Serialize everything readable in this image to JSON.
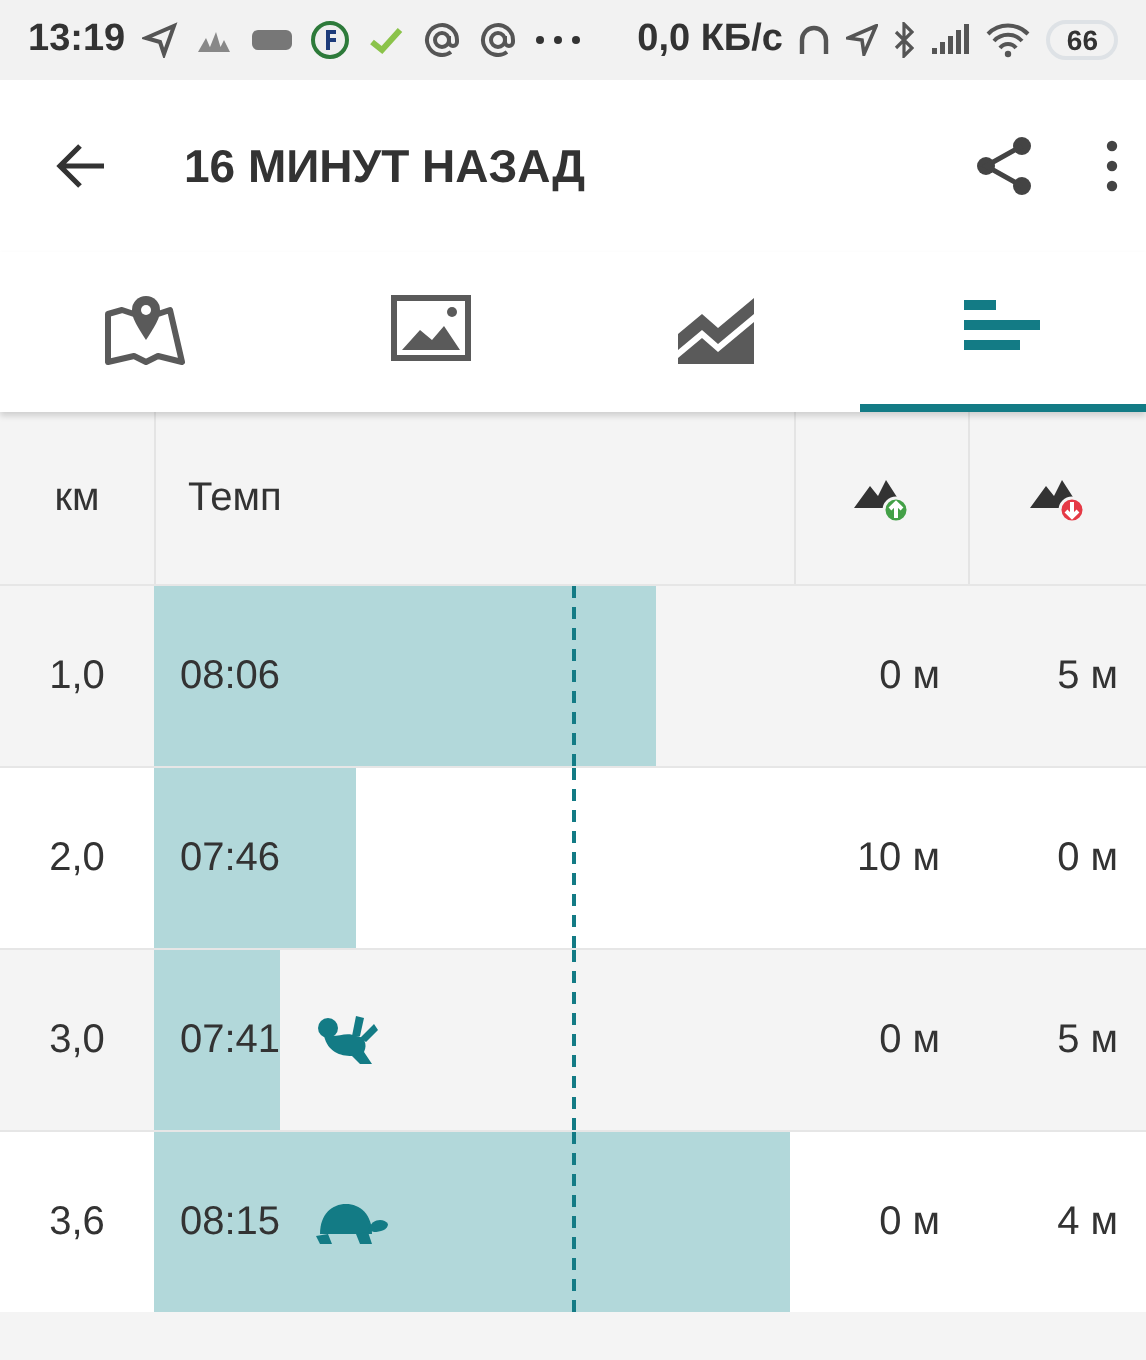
{
  "status_bar": {
    "time": "13:19",
    "speed": "0,0 КБ/с",
    "battery": "66"
  },
  "app_bar": {
    "title": "16 МИНУТ НАЗАД"
  },
  "tabs": [
    {
      "kind": "map",
      "selected": false
    },
    {
      "kind": "photos",
      "selected": false
    },
    {
      "kind": "elevation",
      "selected": false
    },
    {
      "kind": "splits",
      "selected": true
    }
  ],
  "table": {
    "columns": [
      {
        "kind": "text",
        "label": "км"
      },
      {
        "kind": "text",
        "label": "Темп"
      },
      {
        "kind": "ascent"
      },
      {
        "kind": "descent"
      }
    ],
    "rows": [
      {
        "kind": "split",
        "km": "1,0",
        "pace": "08:06",
        "ascent": "0 м",
        "descent": "5 м"
      },
      {
        "kind": "split",
        "km": "2,0",
        "pace": "07:46",
        "ascent": "10 м",
        "descent": "0 м"
      },
      {
        "kind": "fastest",
        "km": "3,0",
        "pace": "07:41",
        "ascent": "0 м",
        "descent": "5 м"
      },
      {
        "kind": "slowest",
        "km": "3,6",
        "pace": "08:15",
        "ascent": "0 м",
        "descent": "4 м"
      }
    ]
  }
}
